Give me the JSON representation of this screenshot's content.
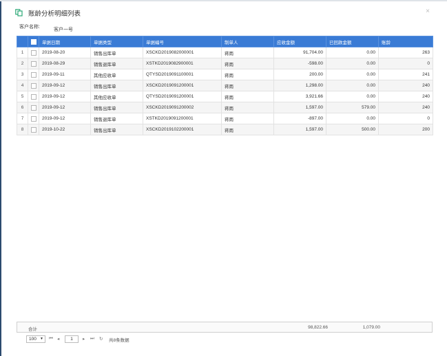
{
  "dialog": {
    "title": "账龄分析明细列表",
    "close_symbol": "×"
  },
  "customer": {
    "label": "客户名称:",
    "value": "客户一号"
  },
  "table": {
    "columns": [
      "单据日期",
      "单据类型",
      "单据编号",
      "制单人",
      "应收金额",
      "已回款金额",
      "账龄"
    ],
    "rows": [
      {
        "no": "1",
        "date": "2019-08-20",
        "type": "销售出库单",
        "code": "XSCKD2019082000001",
        "maker": "蒋雨",
        "receivable": "91,704.00",
        "received": "0.00",
        "age": "263"
      },
      {
        "no": "2",
        "date": "2019-08-29",
        "type": "销售退库单",
        "code": "XSTKD2019082900001",
        "maker": "蒋雨",
        "receivable": "-598.00",
        "received": "0.00",
        "age": "0"
      },
      {
        "no": "3",
        "date": "2019-09-11",
        "type": "其他应收单",
        "code": "QTYSD2019091100001",
        "maker": "蒋雨",
        "receivable": "200.00",
        "received": "0.00",
        "age": "241"
      },
      {
        "no": "4",
        "date": "2019-09-12",
        "type": "销售出库单",
        "code": "XSCKD2019091200001",
        "maker": "蒋雨",
        "receivable": "1,298.00",
        "received": "0.00",
        "age": "240"
      },
      {
        "no": "5",
        "date": "2019-09-12",
        "type": "其他应收单",
        "code": "QTYSD2019091200001",
        "maker": "蒋雨",
        "receivable": "3,921.66",
        "received": "0.00",
        "age": "240"
      },
      {
        "no": "6",
        "date": "2019-09-12",
        "type": "销售出库单",
        "code": "XSCKD2019091200002",
        "maker": "蒋雨",
        "receivable": "1,597.00",
        "received": "579.00",
        "age": "240"
      },
      {
        "no": "7",
        "date": "2019-09-12",
        "type": "销售退库单",
        "code": "XSTKD2019091200001",
        "maker": "蒋雨",
        "receivable": "-897.00",
        "received": "0.00",
        "age": "0"
      },
      {
        "no": "8",
        "date": "2019-10-22",
        "type": "销售出库单",
        "code": "XSCKD2019102200001",
        "maker": "蒋雨",
        "receivable": "1,597.00",
        "received": "500.00",
        "age": "200"
      }
    ]
  },
  "summary": {
    "label": "合计",
    "receivable_total": "98,822.66",
    "received_total": "1,079.00"
  },
  "pager": {
    "page_size": "100",
    "first": "⏮",
    "prev": "◂",
    "current_page": "1",
    "next": "▸",
    "last": "⏭",
    "refresh": "↻",
    "total_text": "共8条数据"
  },
  "colors": {
    "header_blue": "#3a7bd5",
    "icon_green": "#2aa876"
  }
}
